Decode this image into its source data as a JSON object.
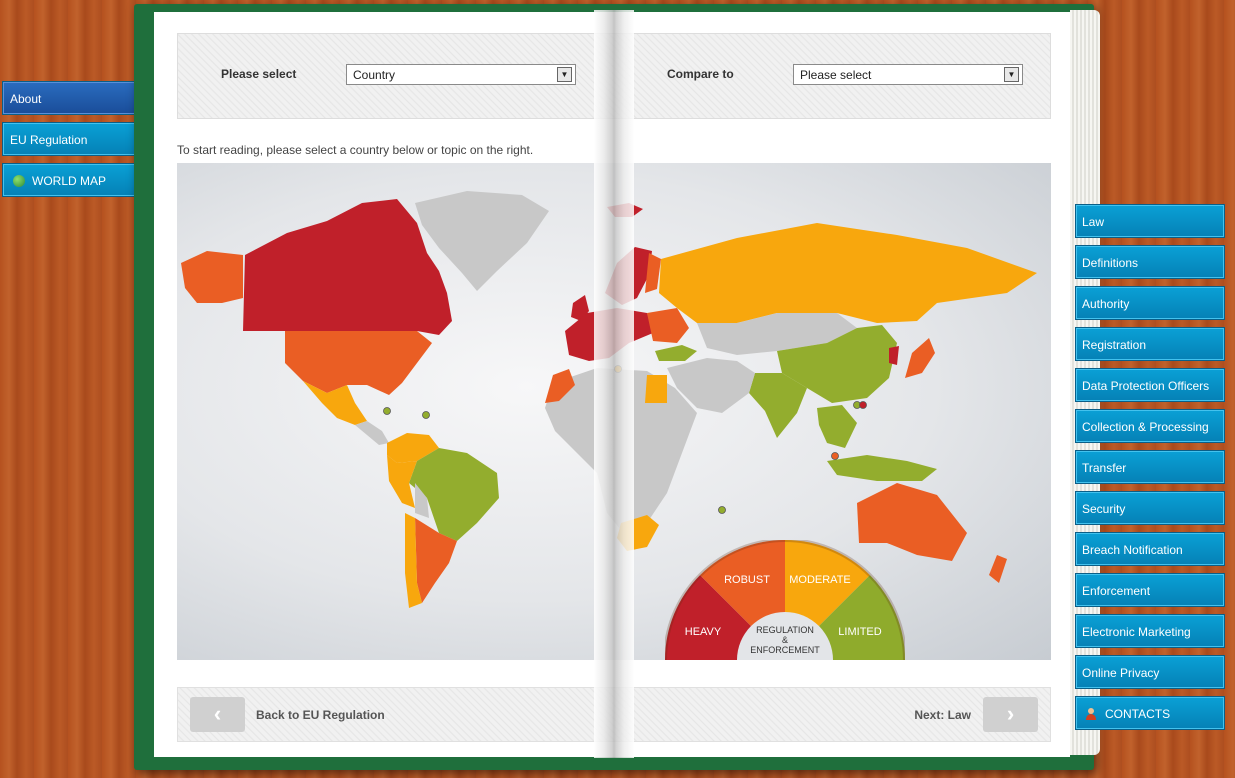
{
  "left_nav": {
    "items": [
      {
        "label": "About"
      },
      {
        "label": "EU Regulation"
      },
      {
        "label": "WORLD MAP"
      }
    ]
  },
  "selector": {
    "please_select_label": "Please select",
    "country_value": "Country",
    "compare_label": "Compare to",
    "compare_value": "Please select"
  },
  "intro_text": "To start reading, please select a country below or topic on the right.",
  "legend": {
    "heavy": "HEAVY",
    "robust": "ROBUST",
    "moderate": "MODERATE",
    "limited": "LIMITED",
    "center_line1": "REGULATION",
    "center_line2": "&",
    "center_line3": "ENFORCEMENT",
    "colors": {
      "heavy": "#c0202a",
      "robust": "#ea5e24",
      "moderate": "#f8a70d",
      "limited": "#93ad2e",
      "none": "#c8c8c8"
    }
  },
  "footer": {
    "back_label": "Back to EU Regulation",
    "next_label": "Next: Law"
  },
  "right_nav": {
    "items": [
      {
        "label": "Law"
      },
      {
        "label": "Definitions"
      },
      {
        "label": "Authority"
      },
      {
        "label": "Registration"
      },
      {
        "label": "Data Protection Officers"
      },
      {
        "label": "Collection & Processing"
      },
      {
        "label": "Transfer"
      },
      {
        "label": "Security"
      },
      {
        "label": "Breach Notification"
      },
      {
        "label": "Enforcement"
      },
      {
        "label": "Electronic Marketing"
      },
      {
        "label": "Online Privacy"
      },
      {
        "label": "CONTACTS"
      }
    ]
  }
}
